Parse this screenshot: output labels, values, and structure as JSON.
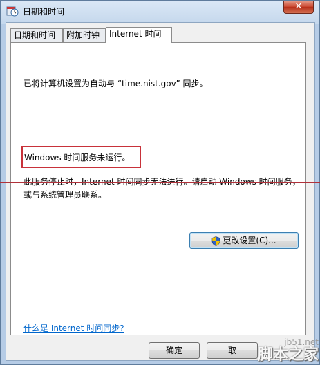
{
  "window": {
    "title": "日期和时间",
    "close_glyph": "✕"
  },
  "tabs": [
    {
      "label": "日期和时间"
    },
    {
      "label": "附加时钟"
    },
    {
      "label": "Internet 时间"
    }
  ],
  "panel": {
    "sync_status": "已将计算机设置为自动与 “time.nist.gov” 同步。",
    "service_status": "Windows 时间服务未运行。",
    "service_msg_line1": "此服务停止时，Internet 时间同步无法进行。请启动 Windows 时间服务，",
    "service_msg_line2": "或与系统管理员联系。",
    "change_settings_label": "更改设置(C)...",
    "help_link": "什么是 Internet 时间同步?"
  },
  "buttons": {
    "ok": "确定",
    "cancel": "取"
  },
  "watermark": {
    "url": "jb51.net",
    "brand": "脚本之家"
  },
  "colors": {
    "highlight_box": "#c8323a",
    "link": "#0066cc"
  }
}
